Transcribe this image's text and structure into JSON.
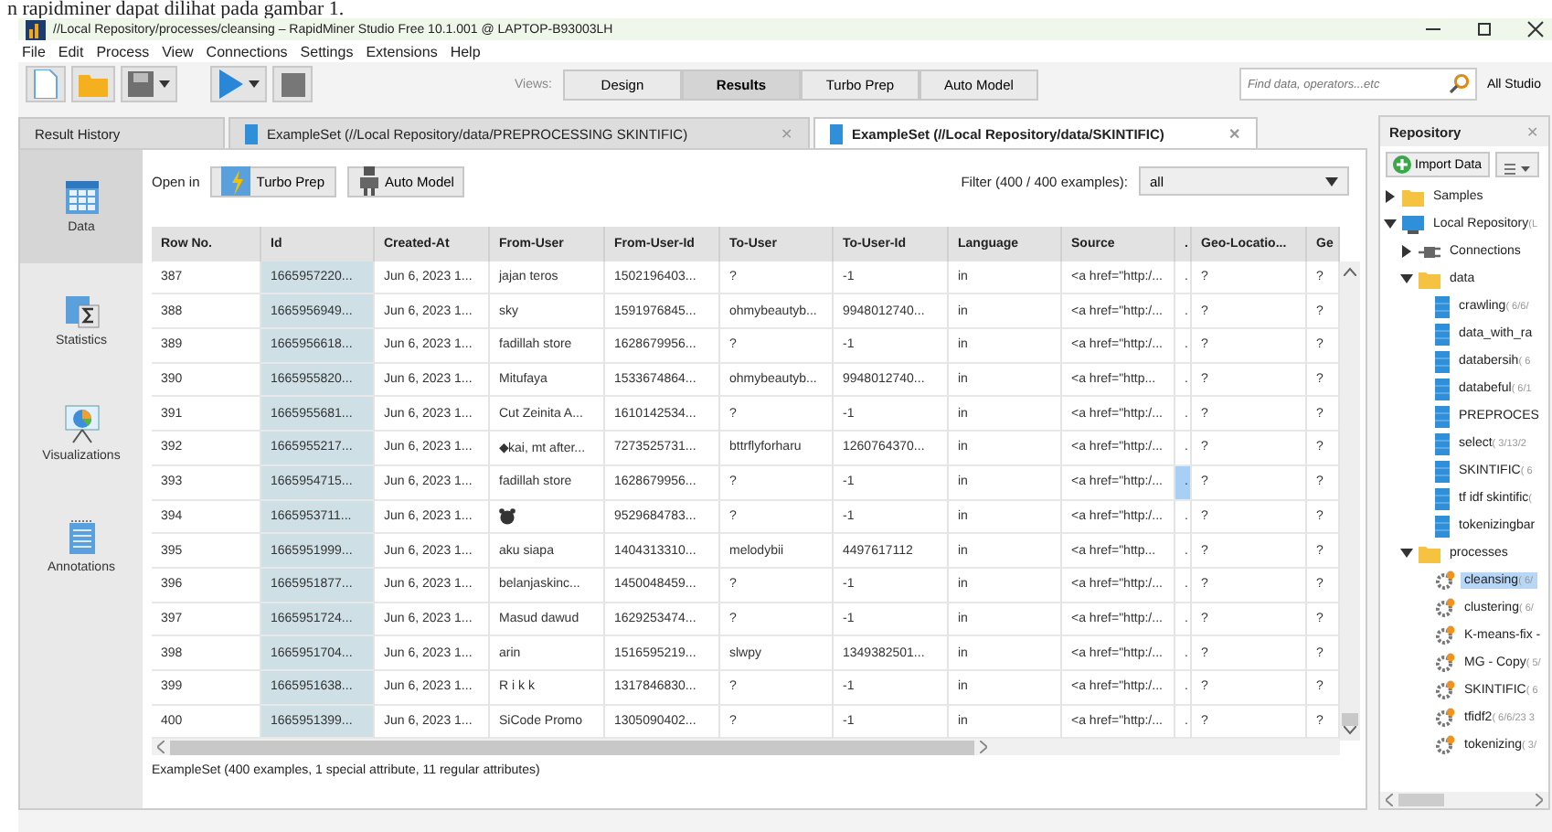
{
  "document_text": "n rapidminer dapat dilihat pada gambar 1.",
  "window": {
    "title": "//Local Repository/processes/cleansing – RapidMiner Studio Free 10.1.001 @ LAPTOP-B93003LH"
  },
  "menu": [
    "File",
    "Edit",
    "Process",
    "View",
    "Connections",
    "Settings",
    "Extensions",
    "Help"
  ],
  "views": {
    "label": "Views:",
    "items": [
      {
        "label": "Design",
        "selected": false
      },
      {
        "label": "Results",
        "selected": true
      },
      {
        "label": "Turbo Prep",
        "selected": false
      },
      {
        "label": "Auto Model",
        "selected": false
      }
    ]
  },
  "search": {
    "placeholder": "Find data, operators...etc",
    "scope": "All Studio"
  },
  "tabs": [
    {
      "label": "Result History",
      "selected": false,
      "closable": false
    },
    {
      "label": "ExampleSet (//Local Repository/data/PREPROCESSING SKINTIFIC)",
      "selected": false,
      "closable": true
    },
    {
      "label": "ExampleSet (//Local Repository/data/SKINTIFIC)",
      "selected": true,
      "closable": true
    }
  ],
  "close_glyph": "✕",
  "side_nav": [
    {
      "label": "Data",
      "selected": true,
      "kind": "data"
    },
    {
      "label": "Statistics",
      "selected": false,
      "kind": "statistics"
    },
    {
      "label": "Visualizations",
      "selected": false,
      "kind": "visualizations"
    },
    {
      "label": "Annotations",
      "selected": false,
      "kind": "annotations"
    }
  ],
  "open_in": {
    "label": "Open in",
    "buttons": [
      {
        "label": "Turbo Prep",
        "kind": "turbo"
      },
      {
        "label": "Auto Model",
        "kind": "auto"
      }
    ]
  },
  "filter": {
    "label": "Filter (400 / 400 examples):",
    "value": "all"
  },
  "table": {
    "columns": [
      {
        "label": "Row No.",
        "special": false
      },
      {
        "label": "Id",
        "special": true
      },
      {
        "label": "Created-At",
        "special": false
      },
      {
        "label": "From-User",
        "special": false
      },
      {
        "label": "From-User-Id",
        "special": false
      },
      {
        "label": "To-User",
        "special": false
      },
      {
        "label": "To-User-Id",
        "special": false
      },
      {
        "label": "Language",
        "special": false
      },
      {
        "label": "Source",
        "special": false
      },
      {
        "label": ".",
        "special": false
      },
      {
        "label": "Geo-Locatio...",
        "special": false
      },
      {
        "label": "Ge",
        "special": false
      }
    ],
    "rows": [
      {
        "selected": false,
        "cells": [
          "387",
          "1665957220...",
          "Jun 6, 2023 1...",
          "jajan teros",
          "1502196403...",
          "?",
          "-1",
          "in",
          "<a href=\"http:/...",
          ".",
          "?",
          "?"
        ]
      },
      {
        "selected": false,
        "cells": [
          "388",
          "1665956949...",
          "Jun 6, 2023 1...",
          "sky",
          "1591976845...",
          "ohmybeautyb...",
          "9948012740...",
          "in",
          "<a href=\"http:/...",
          ".",
          "?",
          "?"
        ]
      },
      {
        "selected": false,
        "cells": [
          "389",
          "1665956618...",
          "Jun 6, 2023 1...",
          "fadillah store",
          "1628679956...",
          "?",
          "-1",
          "in",
          "<a href=\"http:/...",
          ".",
          "?",
          "?"
        ]
      },
      {
        "selected": false,
        "cells": [
          "390",
          "1665955820...",
          "Jun 6, 2023 1...",
          "Mitufaya",
          "1533674864...",
          "ohmybeautyb...",
          "9948012740...",
          "in",
          "<a href=\"http...",
          ".",
          "?",
          "?"
        ]
      },
      {
        "selected": false,
        "cells": [
          "391",
          "1665955681...",
          "Jun 6, 2023 1...",
          "Cut Zeinita A...",
          "1610142534...",
          "?",
          "-1",
          "in",
          "<a href=\"http:/...",
          ".",
          "?",
          "?"
        ]
      },
      {
        "selected": false,
        "cells": [
          "392",
          "1665955217...",
          "Jun 6, 2023 1...",
          "◆kai, mt after...",
          "7273525731...",
          "bttrflyforharu",
          "1260764370...",
          "in",
          "<a href=\"http:/...",
          ".",
          "?",
          "?"
        ]
      },
      {
        "selected": true,
        "cells": [
          "393",
          "1665954715...",
          "Jun 6, 2023 1...",
          "fadillah store",
          "1628679956...",
          "?",
          "-1",
          "in",
          "<a href=\"http:/...",
          ".",
          "?",
          "?"
        ]
      },
      {
        "selected": false,
        "cells": [
          "394",
          "1665953711...",
          "Jun 6, 2023 1...",
          null,
          "9529684783...",
          "?",
          "-1",
          "in",
          "<a href=\"http:/...",
          ".",
          "?",
          "?"
        ]
      },
      {
        "selected": false,
        "cells": [
          "395",
          "1665951999...",
          "Jun 6, 2023 1...",
          "aku siapa",
          "1404313310...",
          "melodybii",
          "4497617112",
          "in",
          "<a href=\"http...",
          ".",
          "?",
          "?"
        ]
      },
      {
        "selected": false,
        "cells": [
          "396",
          "1665951877...",
          "Jun 6, 2023 1...",
          "belanjaskinc...",
          "1450048459...",
          "?",
          "-1",
          "in",
          "<a href=\"http:/...",
          ".",
          "?",
          "?"
        ]
      },
      {
        "selected": false,
        "cells": [
          "397",
          "1665951724...",
          "Jun 6, 2023 1...",
          "Masud dawud",
          "1629253474...",
          "?",
          "-1",
          "in",
          "<a href=\"http:/...",
          ".",
          "?",
          "?"
        ]
      },
      {
        "selected": false,
        "cells": [
          "398",
          "1665951704...",
          "Jun 6, 2023 1...",
          "arin",
          "1516595219...",
          "slwpy",
          "1349382501...",
          "in",
          "<a href=\"http:/...",
          ".",
          "?",
          "?"
        ]
      },
      {
        "selected": false,
        "cells": [
          "399",
          "1665951638...",
          "Jun 6, 2023 1...",
          "R i k k",
          "1317846830...",
          "?",
          "-1",
          "in",
          "<a href=\"http:/...",
          ".",
          "?",
          "?"
        ]
      },
      {
        "selected": false,
        "cells": [
          "400",
          "1665951399...",
          "Jun 6, 2023 1...",
          "SiCode Promo",
          "1305090402...",
          "?",
          "-1",
          "in",
          "<a href=\"http:/...",
          ".",
          "?",
          "?"
        ]
      }
    ]
  },
  "status": "ExampleSet (400 examples, 1 special attribute, 11 regular attributes)",
  "repository": {
    "title": "Repository",
    "import_label": "Import Data",
    "tree": [
      {
        "name": "Samples",
        "kind": "folder",
        "expanded": false,
        "selected": false
      },
      {
        "name": "Local Repository",
        "meta": "(L",
        "kind": "repository",
        "expanded": true,
        "selected": false,
        "children": [
          {
            "name": "Connections",
            "kind": "connections",
            "expanded": false,
            "selected": false
          },
          {
            "name": "data",
            "kind": "folder",
            "expanded": true,
            "selected": false,
            "children": [
              {
                "name": "crawling",
                "meta": "( 6/6/",
                "kind": "data",
                "selected": false
              },
              {
                "name": "data_with_ra",
                "kind": "data",
                "selected": false
              },
              {
                "name": "databersih",
                "meta": "( 6",
                "kind": "data",
                "selected": false
              },
              {
                "name": "databeful",
                "meta": "( 6/1",
                "kind": "data",
                "selected": false
              },
              {
                "name": "PREPROCES",
                "kind": "data",
                "selected": false
              },
              {
                "name": "select",
                "meta": "( 3/13/2",
                "kind": "data",
                "selected": false
              },
              {
                "name": "SKINTIFIC",
                "meta": "( 6",
                "kind": "data",
                "selected": false
              },
              {
                "name": "tf idf skintific",
                "meta": "(",
                "kind": "data",
                "selected": false
              },
              {
                "name": "tokenizingbar",
                "kind": "data",
                "selected": false
              }
            ]
          },
          {
            "name": "processes",
            "kind": "folder",
            "expanded": true,
            "selected": false,
            "children": [
              {
                "name": "cleansing",
                "meta": "( 6/",
                "kind": "process",
                "selected": true
              },
              {
                "name": "clustering",
                "meta": "( 6/",
                "kind": "process",
                "selected": false
              },
              {
                "name": "K-means-fix -",
                "kind": "process",
                "selected": false
              },
              {
                "name": "MG - Copy",
                "meta": "( 5/",
                "kind": "process",
                "selected": false
              },
              {
                "name": "SKINTIFIC",
                "meta": "( 6",
                "kind": "process",
                "selected": false
              },
              {
                "name": "tfidf2",
                "meta": "( 6/6/23 3",
                "kind": "process",
                "selected": false
              },
              {
                "name": "tokenizing",
                "meta": "( 3/",
                "kind": "process",
                "selected": false
              }
            ]
          }
        ]
      }
    ]
  }
}
